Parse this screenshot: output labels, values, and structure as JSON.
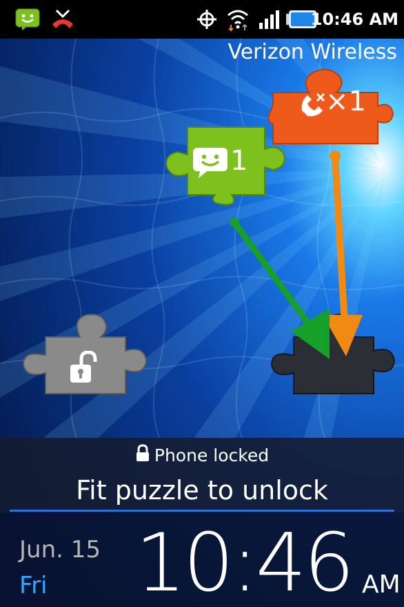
{
  "status_bar": {
    "time": "10:46 AM",
    "icons": [
      "messaging-icon",
      "missed-call-icon",
      "gps-icon",
      "wifi-icon",
      "signal-bars-icon",
      "battery-icon"
    ]
  },
  "carrier": "Verizon Wireless",
  "notifications": {
    "missed_calls": {
      "icon": "missed-call-icon",
      "count_label": "×1"
    },
    "messages": {
      "icon": "message-icon",
      "count_label": "1"
    }
  },
  "lock": {
    "status": "Phone locked",
    "instruction": "Fit puzzle to unlock"
  },
  "clock": {
    "date": "Jun. 15",
    "day": "Fri",
    "time": "10:46",
    "ampm": "AM"
  },
  "colors": {
    "orange_piece": "#ee5a1c",
    "green_piece": "#7ec11f",
    "gray_piece": "#8a8a8a",
    "green_arrow": "#16a02a",
    "orange_arrow": "#f08a12",
    "day_blue": "#35a6ff",
    "background_blue": "#0a3fa0"
  }
}
